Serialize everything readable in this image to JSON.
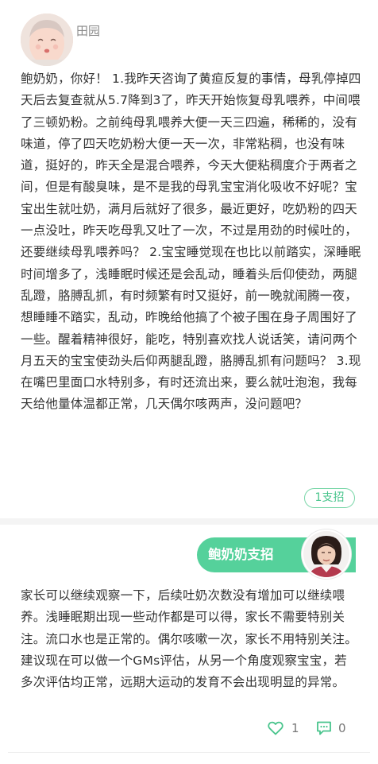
{
  "question": {
    "asker_name": "田园",
    "avatar_icon": "baby-photo",
    "text": "鲍奶奶，你好！ 1.我昨天咨询了黄疸反复的事情，母乳停掉四天后去复查就从5.7降到3了，昨天开始恢复母乳喂养，中间喂了三顿奶粉。之前纯母乳喂养大便一天三四遍，稀稀的，没有味道，停了四天吃奶粉大便一天一次，非常粘稠，也没有味道，挺好的，昨天全是混合喂养，今天大便粘稠度介于两者之间，但是有酸臭味，是不是我的母乳宝宝消化吸收不好呢？宝宝出生就吐奶，满月后就好了很多，最近更好，吃奶粉的四天一点没吐，昨天吃母乳又吐了一次，不过是用劲的时候吐的，还要继续母乳喂养吗？ 2.宝宝睡觉现在也比以前踏实，深睡眠时间增多了，浅睡眠时候还是会乱动，睡着头后仰使劲，两腿乱蹬，胳膊乱抓，有时频繁有时又挺好，前一晚就闹腾一夜，想睡睡不踏实，乱动，昨晚给他搞了个被子围在身子周围好了一些。醒着精神很好，能吃，特别喜欢找人说话笑，请问两个月五天的宝宝使劲头后仰两腿乱蹬，胳膊乱抓有问题吗？ 3.现在嘴巴里面口水特别多，有时还流出来，要么就吐泡泡，我每天给他量体温都正常，几天偶尔咳两声，没问题吧？",
    "support_button_label": "1支招"
  },
  "answer": {
    "banner_label": "鲍奶奶支招",
    "doctor_avatar_icon": "doctor-photo",
    "text": "家长可以继续观察一下，后续吐奶次数没有增加可以继续喂养。浅睡眠期出现一些动作都是可以得，家长不需要特别关注。流口水也是正常的。偶尔咳嗽一次，家长不用特别关注。建议现在可以做一个GMs评估，从另一个角度观察宝宝，若多次评估均正常，远期大运动的发育不会出现明显的异常。",
    "like_count": "1",
    "comment_count": "0"
  },
  "colors": {
    "accent_green": "#55d19b",
    "text_main": "#333333",
    "text_muted": "#8a8a8a"
  }
}
